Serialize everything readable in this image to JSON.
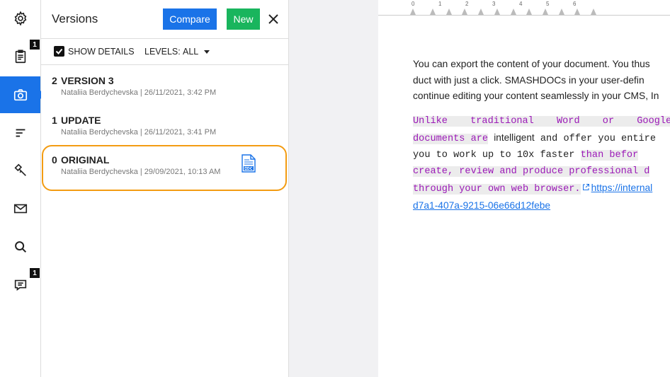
{
  "rail": {
    "items": [
      {
        "name": "settings",
        "badge": ""
      },
      {
        "name": "tasks",
        "badge": "1"
      },
      {
        "name": "versions",
        "badge": ""
      },
      {
        "name": "outline",
        "badge": ""
      },
      {
        "name": "tools",
        "badge": ""
      },
      {
        "name": "mail",
        "badge": ""
      },
      {
        "name": "search",
        "badge": ""
      },
      {
        "name": "comments",
        "badge": "1"
      }
    ]
  },
  "panel": {
    "title": "Versions",
    "compare_label": "Compare",
    "new_label": "New",
    "show_details_label": "SHOW DETAILS",
    "levels_label": "LEVELS:",
    "levels_value": "ALL",
    "versions": [
      {
        "num": "2",
        "name": "VERSION 3",
        "meta": "Nataliia Berdychevska | 26/11/2021, 3:42 PM"
      },
      {
        "num": "1",
        "name": "UPDATE",
        "meta": "Nataliia Berdychevska | 26/11/2021, 3:41 PM"
      },
      {
        "num": "0",
        "name": "ORIGINAL",
        "meta": "Nataliia Berdychevska | 29/09/2021, 10:13 AM"
      }
    ]
  },
  "ruler": {
    "labels": [
      "0",
      "1",
      "2",
      "3",
      "4",
      "5",
      "6"
    ]
  },
  "document": {
    "p1_line1": "You can export the content of your document. You thus",
    "p1_line2": "duct with just a click. SMASHDOCs in your user-defin",
    "p1_line3": "continue editing your content seamlessly in your CMS, In",
    "p2_line1": "Unlike traditional Word or Google D",
    "p2_line2a": "documents are",
    "p2_line2b": "intelligent",
    "p2_line2c": "and offer you entire",
    "p2_line3a": "you to work up to 10x faster",
    "p2_line3b": "than befor",
    "p2_line4": "create, review and produce professional d",
    "p2_line5a": "through your own web browser.",
    "p2_link1": "https://internal",
    "p2_link2": "d7a1-407a-9215-06e66d12febe"
  },
  "colors": {
    "accent": "#1a73e8",
    "new_button": "#19b55d",
    "highlight": "#f39c12",
    "mono_text": "#9b19b7"
  }
}
